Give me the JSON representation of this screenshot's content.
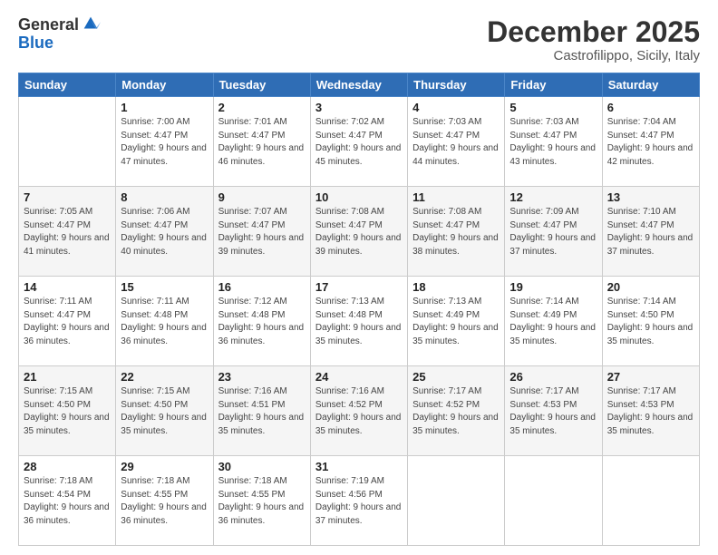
{
  "logo": {
    "general": "General",
    "blue": "Blue"
  },
  "header": {
    "month": "December 2025",
    "location": "Castrofilippo, Sicily, Italy"
  },
  "days_of_week": [
    "Sunday",
    "Monday",
    "Tuesday",
    "Wednesday",
    "Thursday",
    "Friday",
    "Saturday"
  ],
  "weeks": [
    [
      {
        "day": "",
        "sunrise": "",
        "sunset": "",
        "daylight": ""
      },
      {
        "day": "1",
        "sunrise": "Sunrise: 7:00 AM",
        "sunset": "Sunset: 4:47 PM",
        "daylight": "Daylight: 9 hours and 47 minutes."
      },
      {
        "day": "2",
        "sunrise": "Sunrise: 7:01 AM",
        "sunset": "Sunset: 4:47 PM",
        "daylight": "Daylight: 9 hours and 46 minutes."
      },
      {
        "day": "3",
        "sunrise": "Sunrise: 7:02 AM",
        "sunset": "Sunset: 4:47 PM",
        "daylight": "Daylight: 9 hours and 45 minutes."
      },
      {
        "day": "4",
        "sunrise": "Sunrise: 7:03 AM",
        "sunset": "Sunset: 4:47 PM",
        "daylight": "Daylight: 9 hours and 44 minutes."
      },
      {
        "day": "5",
        "sunrise": "Sunrise: 7:03 AM",
        "sunset": "Sunset: 4:47 PM",
        "daylight": "Daylight: 9 hours and 43 minutes."
      },
      {
        "day": "6",
        "sunrise": "Sunrise: 7:04 AM",
        "sunset": "Sunset: 4:47 PM",
        "daylight": "Daylight: 9 hours and 42 minutes."
      }
    ],
    [
      {
        "day": "7",
        "sunrise": "Sunrise: 7:05 AM",
        "sunset": "Sunset: 4:47 PM",
        "daylight": "Daylight: 9 hours and 41 minutes."
      },
      {
        "day": "8",
        "sunrise": "Sunrise: 7:06 AM",
        "sunset": "Sunset: 4:47 PM",
        "daylight": "Daylight: 9 hours and 40 minutes."
      },
      {
        "day": "9",
        "sunrise": "Sunrise: 7:07 AM",
        "sunset": "Sunset: 4:47 PM",
        "daylight": "Daylight: 9 hours and 39 minutes."
      },
      {
        "day": "10",
        "sunrise": "Sunrise: 7:08 AM",
        "sunset": "Sunset: 4:47 PM",
        "daylight": "Daylight: 9 hours and 39 minutes."
      },
      {
        "day": "11",
        "sunrise": "Sunrise: 7:08 AM",
        "sunset": "Sunset: 4:47 PM",
        "daylight": "Daylight: 9 hours and 38 minutes."
      },
      {
        "day": "12",
        "sunrise": "Sunrise: 7:09 AM",
        "sunset": "Sunset: 4:47 PM",
        "daylight": "Daylight: 9 hours and 37 minutes."
      },
      {
        "day": "13",
        "sunrise": "Sunrise: 7:10 AM",
        "sunset": "Sunset: 4:47 PM",
        "daylight": "Daylight: 9 hours and 37 minutes."
      }
    ],
    [
      {
        "day": "14",
        "sunrise": "Sunrise: 7:11 AM",
        "sunset": "Sunset: 4:47 PM",
        "daylight": "Daylight: 9 hours and 36 minutes."
      },
      {
        "day": "15",
        "sunrise": "Sunrise: 7:11 AM",
        "sunset": "Sunset: 4:48 PM",
        "daylight": "Daylight: 9 hours and 36 minutes."
      },
      {
        "day": "16",
        "sunrise": "Sunrise: 7:12 AM",
        "sunset": "Sunset: 4:48 PM",
        "daylight": "Daylight: 9 hours and 36 minutes."
      },
      {
        "day": "17",
        "sunrise": "Sunrise: 7:13 AM",
        "sunset": "Sunset: 4:48 PM",
        "daylight": "Daylight: 9 hours and 35 minutes."
      },
      {
        "day": "18",
        "sunrise": "Sunrise: 7:13 AM",
        "sunset": "Sunset: 4:49 PM",
        "daylight": "Daylight: 9 hours and 35 minutes."
      },
      {
        "day": "19",
        "sunrise": "Sunrise: 7:14 AM",
        "sunset": "Sunset: 4:49 PM",
        "daylight": "Daylight: 9 hours and 35 minutes."
      },
      {
        "day": "20",
        "sunrise": "Sunrise: 7:14 AM",
        "sunset": "Sunset: 4:50 PM",
        "daylight": "Daylight: 9 hours and 35 minutes."
      }
    ],
    [
      {
        "day": "21",
        "sunrise": "Sunrise: 7:15 AM",
        "sunset": "Sunset: 4:50 PM",
        "daylight": "Daylight: 9 hours and 35 minutes."
      },
      {
        "day": "22",
        "sunrise": "Sunrise: 7:15 AM",
        "sunset": "Sunset: 4:50 PM",
        "daylight": "Daylight: 9 hours and 35 minutes."
      },
      {
        "day": "23",
        "sunrise": "Sunrise: 7:16 AM",
        "sunset": "Sunset: 4:51 PM",
        "daylight": "Daylight: 9 hours and 35 minutes."
      },
      {
        "day": "24",
        "sunrise": "Sunrise: 7:16 AM",
        "sunset": "Sunset: 4:52 PM",
        "daylight": "Daylight: 9 hours and 35 minutes."
      },
      {
        "day": "25",
        "sunrise": "Sunrise: 7:17 AM",
        "sunset": "Sunset: 4:52 PM",
        "daylight": "Daylight: 9 hours and 35 minutes."
      },
      {
        "day": "26",
        "sunrise": "Sunrise: 7:17 AM",
        "sunset": "Sunset: 4:53 PM",
        "daylight": "Daylight: 9 hours and 35 minutes."
      },
      {
        "day": "27",
        "sunrise": "Sunrise: 7:17 AM",
        "sunset": "Sunset: 4:53 PM",
        "daylight": "Daylight: 9 hours and 35 minutes."
      }
    ],
    [
      {
        "day": "28",
        "sunrise": "Sunrise: 7:18 AM",
        "sunset": "Sunset: 4:54 PM",
        "daylight": "Daylight: 9 hours and 36 minutes."
      },
      {
        "day": "29",
        "sunrise": "Sunrise: 7:18 AM",
        "sunset": "Sunset: 4:55 PM",
        "daylight": "Daylight: 9 hours and 36 minutes."
      },
      {
        "day": "30",
        "sunrise": "Sunrise: 7:18 AM",
        "sunset": "Sunset: 4:55 PM",
        "daylight": "Daylight: 9 hours and 36 minutes."
      },
      {
        "day": "31",
        "sunrise": "Sunrise: 7:19 AM",
        "sunset": "Sunset: 4:56 PM",
        "daylight": "Daylight: 9 hours and 37 minutes."
      },
      {
        "day": "",
        "sunrise": "",
        "sunset": "",
        "daylight": ""
      },
      {
        "day": "",
        "sunrise": "",
        "sunset": "",
        "daylight": ""
      },
      {
        "day": "",
        "sunrise": "",
        "sunset": "",
        "daylight": ""
      }
    ]
  ]
}
